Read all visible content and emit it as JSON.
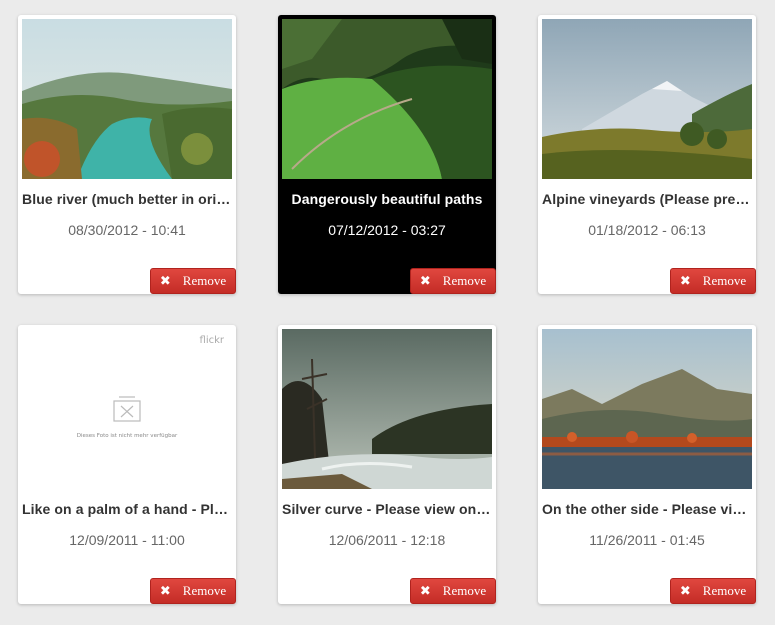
{
  "remove_label": "Remove",
  "remove_icon": "close-icon",
  "cards": [
    {
      "title": "Blue river (much better in original size) - Please view on black",
      "date": "08/30/2012 - 10:41",
      "active": false
    },
    {
      "title": "Dangerously beautiful paths",
      "date": "07/12/2012 - 03:27",
      "active": true
    },
    {
      "title": "Alpine vineyards (Please press L for a better view)",
      "date": "01/18/2012 - 06:13",
      "active": false
    },
    {
      "title": "Like on a palm of a hand - Please view on black",
      "date": "12/09/2011 - 11:00",
      "active": false
    },
    {
      "title": "Silver curve - Please view on black",
      "date": "12/06/2011 - 12:18",
      "active": false
    },
    {
      "title": "On the other side - Please view on black",
      "date": "11/26/2011 - 01:45",
      "active": false
    }
  ],
  "unavailable": {
    "brand": "flickr",
    "message": "Dieses Foto ist nicht mehr verfügbar"
  },
  "colors": {
    "background": "#ebebeb",
    "remove_button": "#d33a33",
    "active_card": "#000000"
  }
}
